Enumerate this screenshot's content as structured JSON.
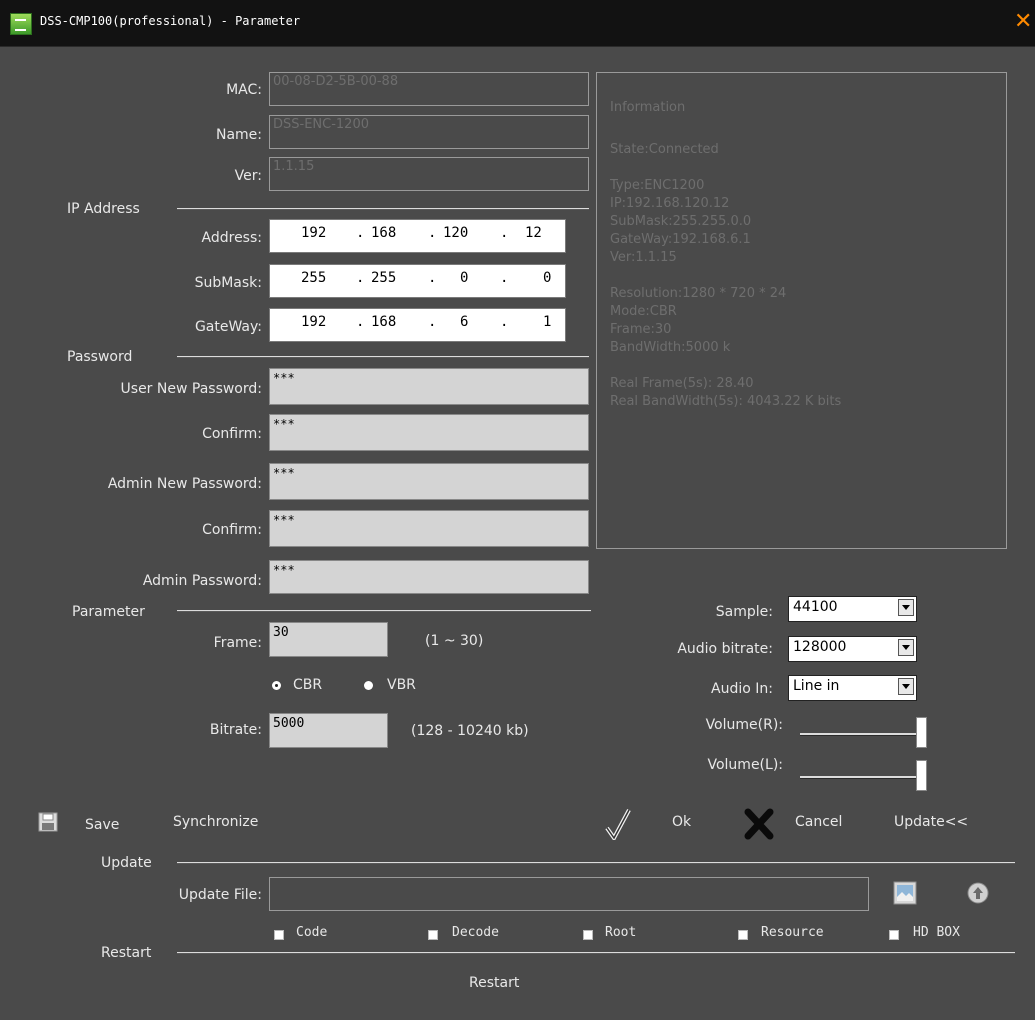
{
  "window": {
    "title": "DSS-CMP100(professional) - Parameter",
    "icons": {
      "app": "app-icon",
      "close": "close-icon"
    },
    "close_glyph": "✕",
    "accent_color": "#ff8a00"
  },
  "device": {
    "mac_label": "MAC:",
    "mac_value": "00-08-D2-5B-00-88",
    "name_label": "Name:",
    "name_value": "DSS-ENC-1200",
    "ver_label": "Ver:",
    "ver_value": "1.1.15"
  },
  "ip_section": {
    "title": "IP Address",
    "address_label": "Address:",
    "address": [
      "192",
      "168",
      "120",
      "12"
    ],
    "submask_label": "SubMask:",
    "submask": [
      "255",
      "255",
      "0",
      "0"
    ],
    "gateway_label": "GateWay:",
    "gateway": [
      "192",
      "168",
      "6",
      "1"
    ],
    "dot": "."
  },
  "password_section": {
    "title": "Password",
    "user_new_label": "User New Password:",
    "user_new_value": "***",
    "user_confirm_label": "Confirm:",
    "user_confirm_value": "***",
    "admin_new_label": "Admin New Password:",
    "admin_new_value": "***",
    "admin_confirm_label": "Confirm:",
    "admin_confirm_value": "***",
    "admin_label": "Admin Password:",
    "admin_value": "***"
  },
  "info": {
    "lines": [
      "Information",
      "",
      "State:Connected",
      "",
      "Type:ENC1200",
      "IP:192.168.120.12",
      "SubMask:255.255.0.0",
      "GateWay:192.168.6.1",
      "Ver:1.1.15",
      "",
      "Resolution:1280 * 720 * 24",
      "Mode:CBR",
      "Frame:30",
      "BandWidth:5000 k",
      "",
      "Real Frame(5s): 28.40",
      "Real BandWidth(5s): 4043.22 K bits"
    ]
  },
  "parameter_section": {
    "title": "Parameter",
    "frame_label": "Frame:",
    "frame_value": "30",
    "frame_hint": "(1 ~ 30)",
    "cbr_label": "CBR",
    "vbr_label": "VBR",
    "mode_selected": "CBR",
    "bitrate_label": "Bitrate:",
    "bitrate_value": "5000",
    "bitrate_hint": "(128 - 10240 kb)"
  },
  "audio": {
    "sample_label": "Sample:",
    "sample_value": "44100",
    "bitrate_label": "Audio bitrate:",
    "bitrate_value": "128000",
    "in_label": "Audio In:",
    "in_value": "Line in",
    "volume_r_label": "Volume(R):",
    "volume_r_level": 1.0,
    "volume_l_label": "Volume(L):",
    "volume_l_level": 1.0
  },
  "actions": {
    "save_label": "Save",
    "synchronize_label": "Synchronize",
    "ok_label": "Ok",
    "cancel_label": "Cancel",
    "update_toggle_label": "Update<<"
  },
  "update_section": {
    "title": "Update",
    "file_label": "Update File:",
    "file_value": "",
    "checkboxes": [
      "Code",
      "Decode",
      "Root",
      "Resource",
      "HD BOX"
    ]
  },
  "restart_section": {
    "title": "Restart",
    "button_label": "Restart"
  }
}
